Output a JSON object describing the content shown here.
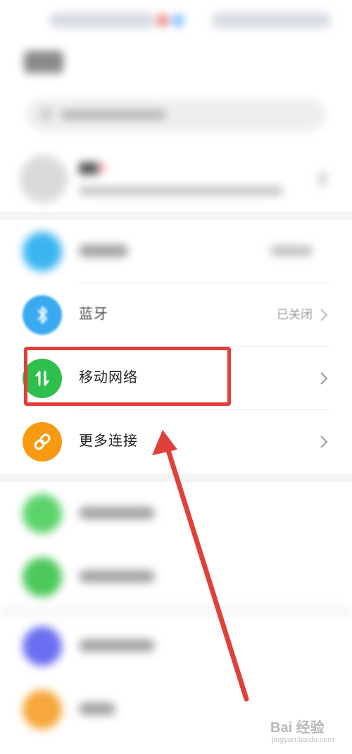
{
  "settings": {
    "items": [
      {
        "id": "bluetooth",
        "label": "蓝牙",
        "value": "已关闭",
        "icon": "bluetooth-icon",
        "color": "#3aaaf0"
      },
      {
        "id": "mobile-network",
        "label": "移动网络",
        "value": "",
        "icon": "mobile-data-icon",
        "color": "#2fbf4c"
      },
      {
        "id": "more-connections",
        "label": "更多连接",
        "value": "",
        "icon": "link-icon",
        "color": "#f79a12"
      }
    ]
  },
  "colors": {
    "annotation_red": "#e0403a",
    "wlan_blue": "#3bb5f1",
    "green_light": "#5cd36a",
    "green": "#4cc95a",
    "indigo": "#6b6ef0",
    "orange": "#f7a73b"
  },
  "watermark": {
    "brand": "Bai 经验",
    "url": "jingyan.baidu.com"
  }
}
